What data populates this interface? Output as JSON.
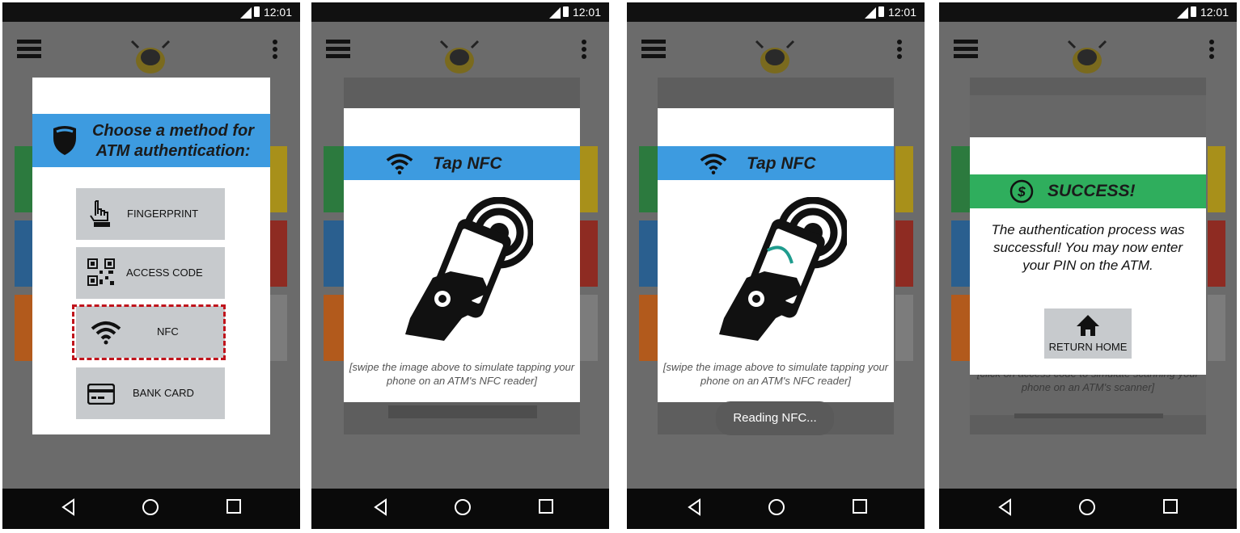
{
  "status_bar": {
    "time": "12:01",
    "network": "3G"
  },
  "screen1": {
    "dialog_title": "Choose a method for ATM authentication:",
    "methods": [
      {
        "label": "FINGERPRINT",
        "icon": "fingerprint-touch-icon"
      },
      {
        "label": "ACCESS CODE",
        "icon": "qr-code-icon"
      },
      {
        "label": "NFC",
        "icon": "wifi-icon",
        "highlighted": true
      },
      {
        "label": "BANK CARD",
        "icon": "credit-card-icon"
      }
    ],
    "highlight_color": "#c0141c"
  },
  "screen2": {
    "title": "Tap NFC",
    "caption": "[swipe the image above to simulate tapping your phone on an ATM's NFC reader]"
  },
  "screen3": {
    "title": "Tap NFC",
    "caption": "[swipe the image above to simulate tapping your phone on an ATM's NFC reader]",
    "toast": "Reading NFC..."
  },
  "screen4": {
    "title": "SUCCESS!",
    "message": "The authentication process was successful! You may now enter your PIN on the ATM.",
    "button_label": "RETURN HOME",
    "background_caption": "[click on access code to simulate scanning your phone on an ATM's scanner]"
  },
  "colors": {
    "banner_blue": "#3d9be0",
    "success_green": "#2fae5d",
    "tile_green": "#2c7a3e",
    "tile_blue": "#2a5f8f",
    "tile_orange": "#b25a1c",
    "tile_yellow": "#a8901a",
    "tile_red": "#8e2b22",
    "tile_gray": "#7c7c7c"
  }
}
